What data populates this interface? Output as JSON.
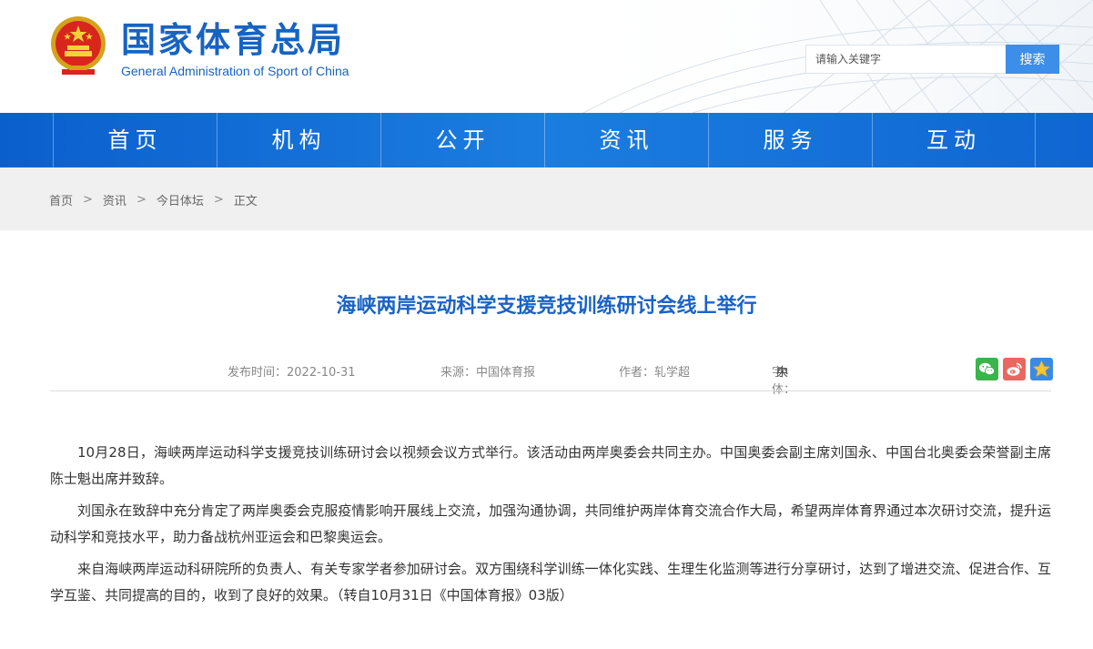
{
  "header": {
    "site_name": "国家体育总局",
    "site_name_en": "General Administration of Sport of China",
    "search_placeholder": "请输入关键字",
    "search_button": "搜索"
  },
  "nav": {
    "items": [
      {
        "label": "首页"
      },
      {
        "label": "机构"
      },
      {
        "label": "公开"
      },
      {
        "label": "资讯"
      },
      {
        "label": "服务"
      },
      {
        "label": "互动"
      }
    ]
  },
  "breadcrumb": {
    "items": [
      {
        "label": "首页"
      },
      {
        "label": "资讯"
      },
      {
        "label": "今日体坛"
      },
      {
        "label": "正文"
      }
    ],
    "separator": ">"
  },
  "article": {
    "title": "海峡两岸运动科学支援竞技训练研讨会线上举行",
    "publish_time": "发布时间：2022-10-31",
    "source": "来源：中国体育报",
    "author": "作者：轧学超",
    "font_label": "字体：",
    "font_sizes": {
      "large": "大",
      "medium": "中",
      "small": "小"
    },
    "share_icons": [
      "wechat-icon",
      "weibo-icon",
      "favorite-star-icon"
    ],
    "paragraphs": [
      "10月28日，海峡两岸运动科学支援竞技训练研讨会以视频会议方式举行。该活动由两岸奥委会共同主办。中国奥委会副主席刘国永、中国台北奥委会荣誉副主席陈士魁出席并致辞。",
      "刘国永在致辞中充分肯定了两岸奥委会克服疫情影响开展线上交流，加强沟通协调，共同维护两岸体育交流合作大局，希望两岸体育界通过本次研讨交流，提升运动科学和竞技水平，助力备战杭州亚运会和巴黎奥运会。",
      "来自海峡两岸运动科研院所的负责人、有关专家学者参加研讨会。双方围绕科学训练一体化实践、生理生化监测等进行分享研讨，达到了增进交流、促进合作、互学互鉴、共同提高的目的，收到了良好的效果。（转自10月31日《中国体育报》03版）"
    ]
  },
  "colors": {
    "brand_blue": "#1763c2",
    "nav_blue": "#1b7de0",
    "title_blue": "#1a63c6",
    "search_button": "#3d8ee8"
  }
}
